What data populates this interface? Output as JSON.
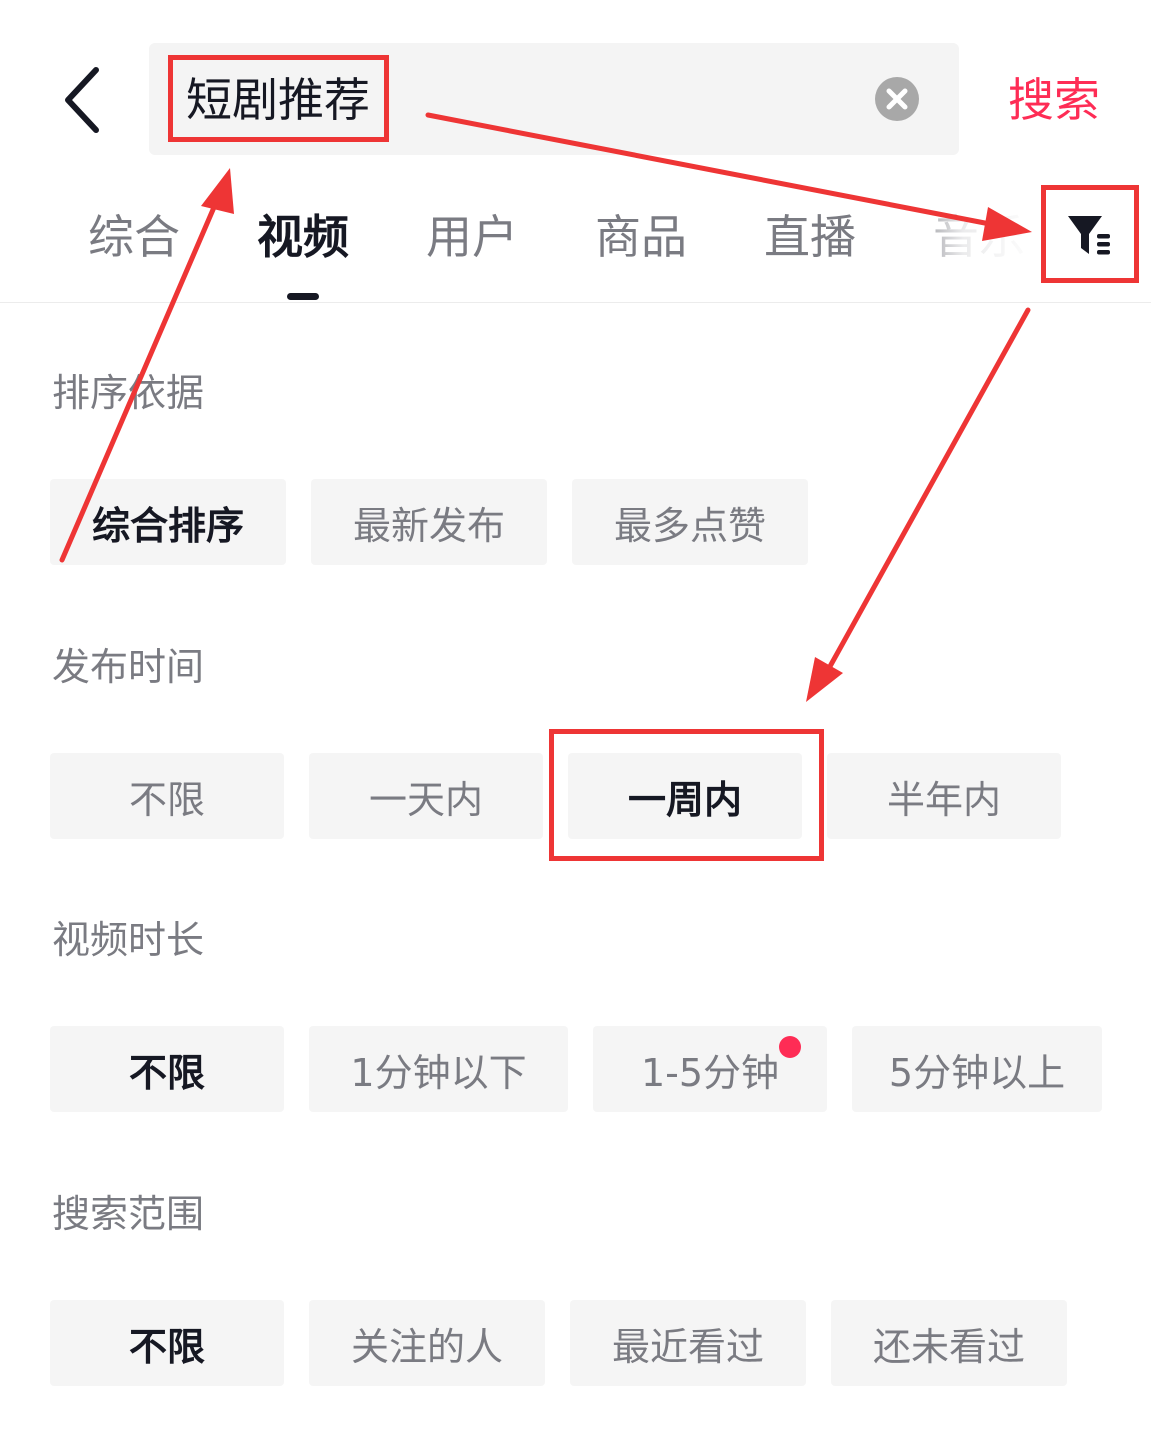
{
  "search": {
    "query": "短剧推荐",
    "search_label": "搜索"
  },
  "tabs": [
    {
      "label": "综合",
      "active": false
    },
    {
      "label": "视频",
      "active": true
    },
    {
      "label": "用户",
      "active": false
    },
    {
      "label": "商品",
      "active": false
    },
    {
      "label": "直播",
      "active": false
    },
    {
      "label": "音乐",
      "active": false
    }
  ],
  "filters": {
    "sort": {
      "title": "排序依据",
      "options": [
        "综合排序",
        "最新发布",
        "最多点赞"
      ],
      "selected": "综合排序"
    },
    "publish_time": {
      "title": "发布时间",
      "options": [
        "不限",
        "一天内",
        "一周内",
        "半年内"
      ],
      "selected": "一周内"
    },
    "duration": {
      "title": "视频时长",
      "options": [
        "不限",
        "1分钟以下",
        "1-5分钟",
        "5分钟以上"
      ],
      "selected": "不限"
    },
    "scope": {
      "title": "搜索范围",
      "options": [
        "不限",
        "关注的人",
        "最近看过",
        "还未看过"
      ],
      "selected": "不限"
    }
  },
  "icons": {
    "back": "chevron-left-icon",
    "clear": "clear-icon",
    "filter": "filter-icon"
  },
  "colors": {
    "accent": "#fe2c55",
    "annotation": "#ee3535",
    "text_primary": "#161823",
    "text_secondary": "#7a7b82",
    "chip_bg": "#f5f5f5"
  }
}
